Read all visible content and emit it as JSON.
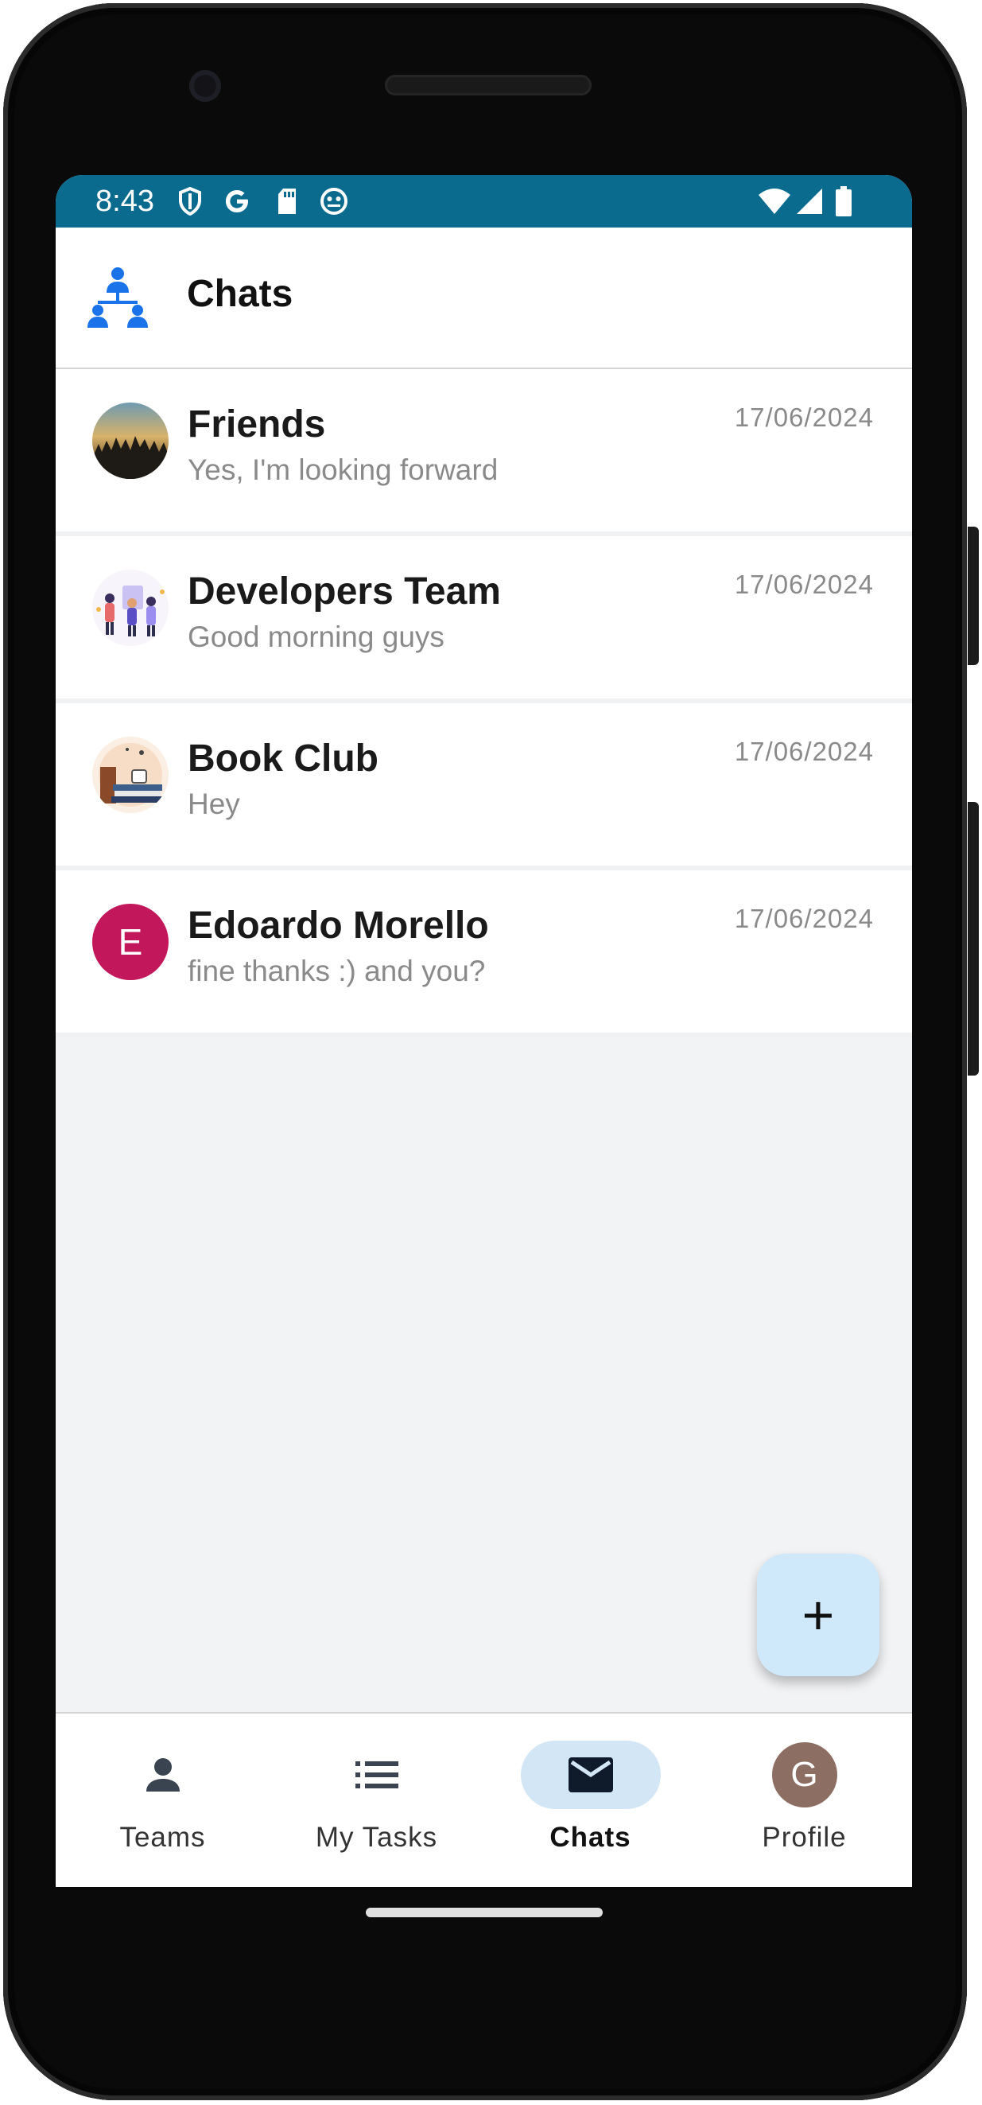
{
  "status_bar": {
    "time": "8:43"
  },
  "app_bar": {
    "title": "Chats"
  },
  "chats": [
    {
      "name": "Friends",
      "last_message": "Yes, I'm looking forward",
      "date": "17/06/2024"
    },
    {
      "name": "Developers Team",
      "last_message": "Good morning guys",
      "date": "17/06/2024"
    },
    {
      "name": "Book Club",
      "last_message": "Hey",
      "date": "17/06/2024"
    },
    {
      "name": "Edoardo Morello",
      "last_message": "fine thanks :) and you?",
      "date": "17/06/2024",
      "avatar_letter": "E",
      "avatar_color": "#c2185b"
    }
  ],
  "fab": {
    "label": "+"
  },
  "bottom_nav": [
    {
      "label": "Teams",
      "icon": "person-icon"
    },
    {
      "label": "My Tasks",
      "icon": "list-icon"
    },
    {
      "label": "Chats",
      "icon": "mail-icon",
      "active": true
    },
    {
      "label": "Profile",
      "icon": "avatar",
      "avatar_letter": "G"
    }
  ],
  "colors": {
    "status_bar": "#0b6b8f",
    "accent": "#1a73e8",
    "fab": "#cfe9fb",
    "nav_active": "#d3e6f5",
    "profile_avatar": "#8d6e63"
  }
}
